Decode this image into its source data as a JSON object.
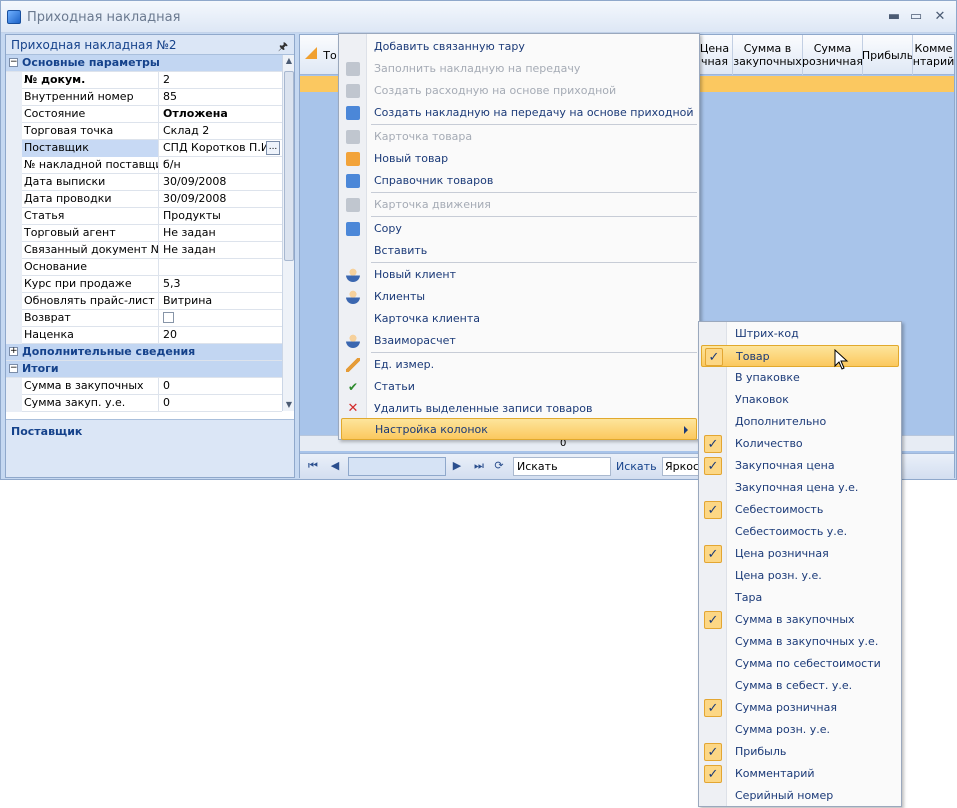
{
  "window": {
    "title": "Приходная накладная",
    "minimize": "▬",
    "maximize": "▭",
    "close": "✕"
  },
  "left_panel": {
    "title": "Приходная накладная №2",
    "cat_main": "Основные параметры",
    "rows": [
      {
        "name": "№ докум.",
        "value": "2"
      },
      {
        "name": "Внутренний номер",
        "value": "85"
      },
      {
        "name": "Состояние",
        "value": "Отложена"
      },
      {
        "name": "Торговая точка",
        "value": "Склад 2"
      },
      {
        "name": "Поставщик",
        "value": "СПД Коротков П.И."
      },
      {
        "name": "№ накладной поставщика",
        "value": "б/н"
      },
      {
        "name": "Дата выписки",
        "value": "30/09/2008"
      },
      {
        "name": "Дата проводки",
        "value": "30/09/2008"
      },
      {
        "name": "Статья",
        "value": "Продукты"
      },
      {
        "name": "Торговый агент",
        "value": "Не задан"
      },
      {
        "name": "Связанный документ №",
        "value": "Не задан"
      },
      {
        "name": "Основание",
        "value": ""
      },
      {
        "name": "Курс при продаже",
        "value": "5,3"
      },
      {
        "name": "Обновлять прайс-лист",
        "value": "Витрина"
      },
      {
        "name": "Возврат",
        "value": ""
      },
      {
        "name": "Наценка",
        "value": "20"
      }
    ],
    "cat_extra": "Дополнительные сведения",
    "cat_totals": "Итоги",
    "totals": [
      {
        "name": "Сумма в закупочных",
        "value": "0"
      },
      {
        "name": "Сумма закуп. у.е.",
        "value": "0"
      }
    ],
    "ellipsis": "...",
    "description_title": "Поставщик"
  },
  "grid": {
    "headers": [
      "То",
      "Цена\nчная",
      "Сумма в\nзакупочных",
      "Сумма\nрозничная",
      "Прибыль",
      "Комме\nнтарий"
    ],
    "bottom_value": "0"
  },
  "navbar": {
    "search_value": "Искать",
    "search_button": "Искать",
    "brightness": "Яркост"
  },
  "context_menu": {
    "items": [
      {
        "label": "Добавить связанную тару",
        "enabled": true
      },
      {
        "label": "Заполнить накладную на передачу",
        "enabled": false
      },
      {
        "label": "Создать расходную на основе приходной",
        "enabled": false
      },
      {
        "label": "Создать накладную на передачу на основе приходной",
        "enabled": true
      },
      {
        "label": "Карточка товара",
        "enabled": false
      },
      {
        "label": "Новый товар",
        "enabled": true
      },
      {
        "label": "Справочник товаров",
        "enabled": true
      },
      {
        "label": "Карточка движения",
        "enabled": false
      },
      {
        "label": "Copy",
        "enabled": true
      },
      {
        "label": "Вставить",
        "enabled": true
      },
      {
        "label": "Новый клиент",
        "enabled": true
      },
      {
        "label": "Клиенты",
        "enabled": true
      },
      {
        "label": "Карточка клиента",
        "enabled": true
      },
      {
        "label": "Взаиморасчет",
        "enabled": true
      },
      {
        "label": "Ед. измер.",
        "enabled": true
      },
      {
        "label": "Статьи",
        "enabled": true
      },
      {
        "label": "Удалить выделенные записи товаров",
        "enabled": true
      },
      {
        "label": "Настройка колонок",
        "enabled": true
      }
    ]
  },
  "columns_menu": {
    "check_glyph": "✓",
    "items": [
      {
        "label": "Штрих-код",
        "checked": false
      },
      {
        "label": "Товар",
        "checked": true
      },
      {
        "label": "В упаковке",
        "checked": false
      },
      {
        "label": "Упаковок",
        "checked": false
      },
      {
        "label": "Дополнительно",
        "checked": false
      },
      {
        "label": "Количество",
        "checked": true
      },
      {
        "label": "Закупочная цена",
        "checked": true
      },
      {
        "label": "Закупочная цена у.е.",
        "checked": false
      },
      {
        "label": "Себестоимость",
        "checked": true
      },
      {
        "label": "Себестоимость у.е.",
        "checked": false
      },
      {
        "label": "Цена розничная",
        "checked": true
      },
      {
        "label": "Цена розн. у.е.",
        "checked": false
      },
      {
        "label": "Тара",
        "checked": false
      },
      {
        "label": "Сумма в закупочных",
        "checked": true
      },
      {
        "label": "Сумма в закупочных у.е.",
        "checked": false
      },
      {
        "label": "Сумма по себестоимости",
        "checked": false
      },
      {
        "label": "Сумма в себест. у.е.",
        "checked": false
      },
      {
        "label": "Сумма розничная",
        "checked": true
      },
      {
        "label": "Сумма розн. у.е.",
        "checked": false
      },
      {
        "label": "Прибыль",
        "checked": true
      },
      {
        "label": "Комментарий",
        "checked": true
      },
      {
        "label": "Серийный номер",
        "checked": false
      }
    ]
  }
}
